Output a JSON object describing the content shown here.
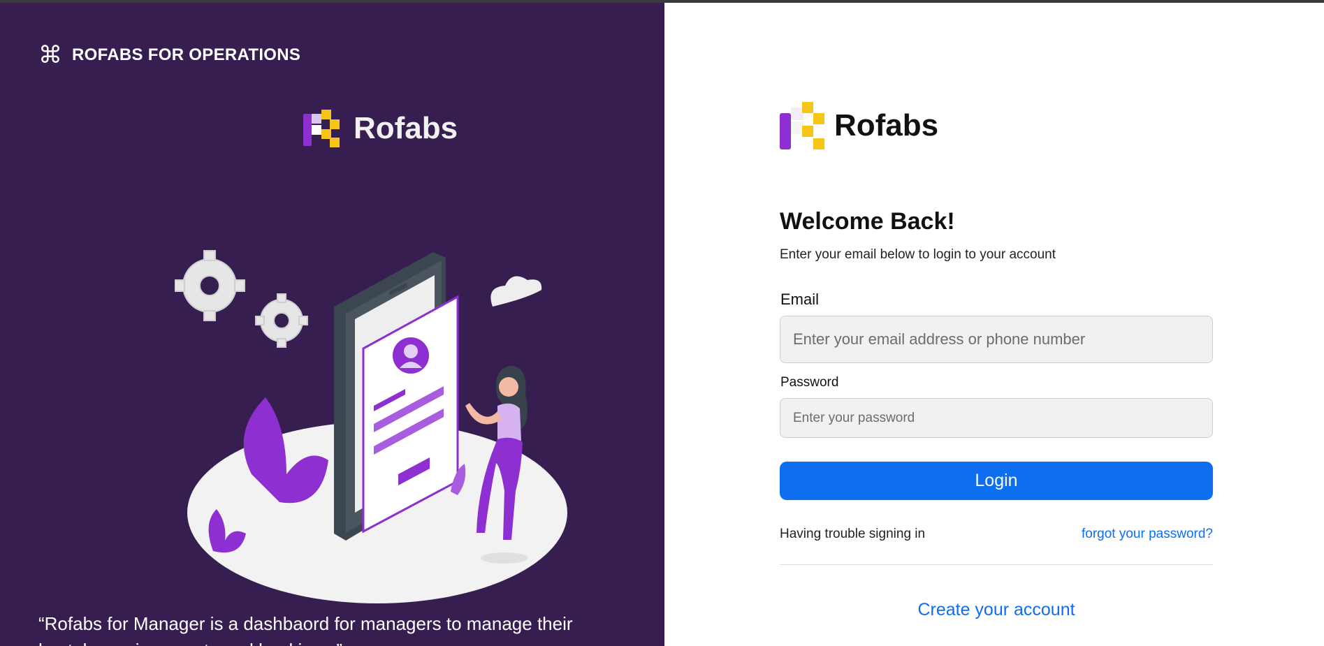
{
  "left_panel": {
    "brand_icon": "command-key-icon",
    "brand_text": "ROFABS FOR OPERATIONS",
    "logo_text": "Rofabs",
    "quote": "“Rofabs for Manager is a dashbaord for managers to manage their hostels, paying guests and bookings.”"
  },
  "login": {
    "logo_text": "Rofabs",
    "title": "Welcome Back!",
    "subtitle": "Enter your email below to login to your account",
    "email_label": "Email",
    "email_placeholder": "Enter your email address or phone number",
    "email_value": "",
    "password_label": "Password",
    "password_placeholder": "Enter your password",
    "password_value": "",
    "login_button": "Login",
    "trouble_text": "Having trouble signing in",
    "forgot_link": "forgot your password?",
    "create_account_link": "Create your account"
  },
  "colors": {
    "left_bg": "#361f50",
    "primary": "#0d6ef0",
    "logo_purple": "#8e2fd1",
    "logo_yellow": "#f5c518"
  }
}
